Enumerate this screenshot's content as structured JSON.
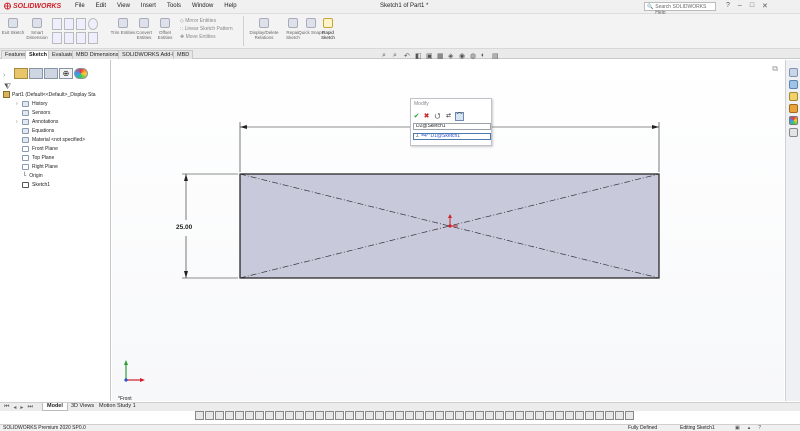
{
  "app": {
    "brand": "SOLIDWORKS",
    "menus": [
      "File",
      "Edit",
      "View",
      "Insert",
      "Tools",
      "Window",
      "Help"
    ],
    "title": "Sketch1 of Part1 *",
    "search_placeholder": "Search SOLIDWORKS Help"
  },
  "ribbon": {
    "buttons": [
      {
        "label": "Exit Sketch"
      },
      {
        "label": "Smart Dimension"
      },
      {
        "label": "Trim Entities"
      },
      {
        "label": "Convert Entities"
      },
      {
        "label": "Offset Entities"
      },
      {
        "label": "Mirror Entities"
      },
      {
        "label": "Linear Sketch Pattern"
      },
      {
        "label": "Move Entities"
      },
      {
        "label": "Display/Delete Relations"
      },
      {
        "label": "Repair Sketch"
      },
      {
        "label": "Quick Snaps"
      },
      {
        "label": "Rapid Sketch"
      }
    ]
  },
  "tabs": [
    "Features",
    "Sketch",
    "Evaluate",
    "MBD Dimensions",
    "SOLIDWORKS Add-Ins",
    "MBD"
  ],
  "active_tab": "Sketch",
  "tree": {
    "root": "Part1 (Default<<Default>_Display Sta",
    "items": [
      "History",
      "Sensors",
      "Annotations",
      "Equations",
      "Material <not specified>",
      "Front Plane",
      "Top Plane",
      "Right Plane",
      "Origin",
      "Sketch1"
    ]
  },
  "canvas": {
    "dimension_vertical": "25.00",
    "view_label": "*Front"
  },
  "modify_dialog": {
    "title": "Modify",
    "name_field": "D2@Sketch1",
    "value_field": "=4*\"D1@Sketch1\""
  },
  "bottom_tabs": [
    "Model",
    "3D Views",
    "Motion Study 1"
  ],
  "status": {
    "product": "SOLIDWORKS Premium 2020 SP0.0",
    "state": "Fully Defined",
    "editing": "Editing Sketch1"
  },
  "colors": {
    "accent": "#d0202a",
    "sketch_fill": "#c8cadc",
    "sketch_line": "#1a1a1a"
  }
}
